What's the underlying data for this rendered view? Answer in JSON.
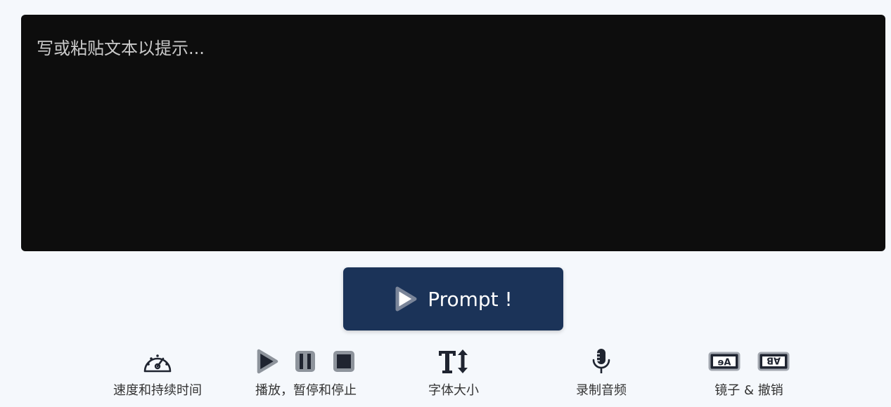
{
  "editor": {
    "placeholder": "写或粘贴文本以提示..."
  },
  "prompt_button": {
    "label": "Prompt !",
    "icon": "play-icon"
  },
  "toolbar": [
    {
      "id": "speed",
      "label": "速度和持续时间",
      "icons": [
        "speedometer-icon"
      ]
    },
    {
      "id": "playback",
      "label": "播放，暂停和停止",
      "icons": [
        "play-icon",
        "pause-icon",
        "stop-icon"
      ]
    },
    {
      "id": "font-size",
      "label": "字体大小",
      "icons": [
        "text-size-icon"
      ]
    },
    {
      "id": "record",
      "label": "录制音频",
      "icons": [
        "microphone-icon"
      ]
    },
    {
      "id": "mirror",
      "label": "镜子 & 撤销",
      "icons": [
        "mirror-icon",
        "mirror-flip-icon"
      ]
    }
  ],
  "mirror_icon_text": {
    "mirror": "ɘA",
    "flip": "AB"
  },
  "colors": {
    "editor_bg": "#0d0d0d",
    "button_bg": "#1b3358",
    "page_bg": "#f5f8fc",
    "icon_grey": "#8e949c",
    "icon_dark": "#1f2430"
  }
}
